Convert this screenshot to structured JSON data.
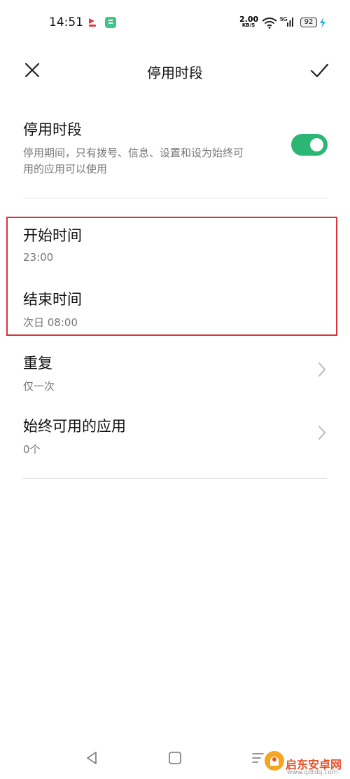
{
  "status_bar": {
    "time": "14:51",
    "net_speed_value": "2.00",
    "net_speed_unit": "KB/S",
    "signal_label": "5G",
    "battery": "92"
  },
  "header": {
    "title": "停用时段",
    "close_icon": "close-icon",
    "confirm_icon": "check-icon"
  },
  "settings": {
    "toggle_title": "停用时段",
    "toggle_description_line1": "停用期间，只有拨号、信息、设置和设为始终可",
    "toggle_description_line2": "用的应用可以使用",
    "toggle_on": true,
    "toggle_color": "#2bb673"
  },
  "schedule": {
    "start_label": "开始时间",
    "start_value": "23:00",
    "end_label": "结束时间",
    "end_value": "次日 08:00"
  },
  "options": {
    "repeat_label": "重复",
    "repeat_value": "仅一次",
    "apps_label": "始终可用的应用",
    "apps_value": "0个"
  },
  "watermark": {
    "name": "启东安卓网",
    "url": "www.qdtdq.com"
  }
}
